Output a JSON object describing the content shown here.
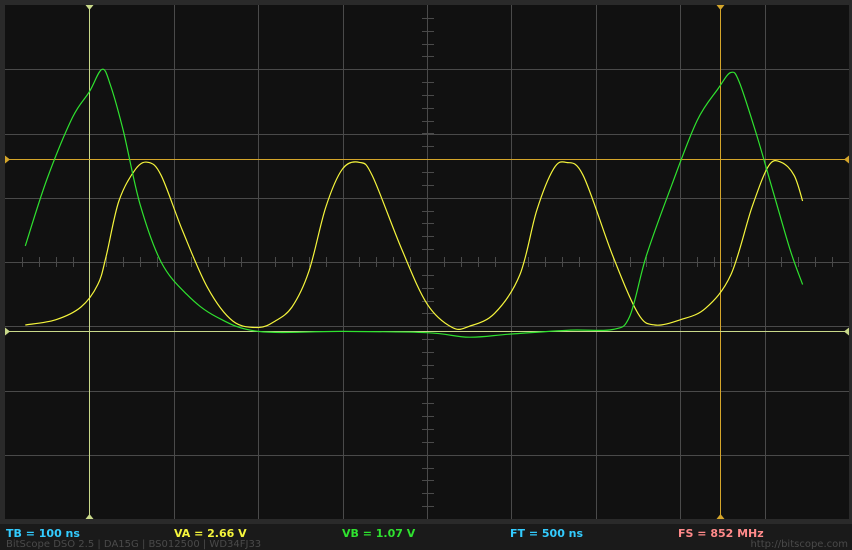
{
  "colors": {
    "background": "#111111",
    "frame": "#2a2a2a",
    "grid": "#4a4a4a",
    "channel_a": "#f5f53c",
    "channel_b": "#2fe22f",
    "cursor_a": "#d4a52a",
    "cursor_b": "#c9d98a",
    "tb": "#33ccff",
    "ft": "#33ccff",
    "fs": "#ff8a8a"
  },
  "readouts": {
    "tb": "TB = 100 ns",
    "va": "VA = 2.66 V",
    "vb": "VB = 1.07 V",
    "ft": "FT = 500 ns",
    "fs": "FS = 852 MHz"
  },
  "footer": {
    "left": "BitScope DSO 2.5 | DA15G | BS012500 | WD34FJ33",
    "right": "http://bitscope.com"
  },
  "chart_data": {
    "type": "line",
    "grid": {
      "divisions_x": 10,
      "divisions_y": 8
    },
    "xlim": [
      0,
      10
    ],
    "ylim": [
      -4,
      4
    ],
    "cursors": {
      "vertical": [
        {
          "channel": "B",
          "x": 1.0
        },
        {
          "channel": "A",
          "x": 8.47
        }
      ],
      "horizontal": [
        {
          "channel": "A",
          "y": 1.6
        },
        {
          "channel": "B",
          "y": -1.07
        }
      ]
    },
    "series": [
      {
        "channel": "A",
        "points": [
          [
            0.24,
            -0.98
          ],
          [
            0.6,
            -0.9
          ],
          [
            0.9,
            -0.7
          ],
          [
            1.1,
            -0.35
          ],
          [
            1.2,
            0.1
          ],
          [
            1.35,
            0.95
          ],
          [
            1.55,
            1.45
          ],
          [
            1.7,
            1.55
          ],
          [
            1.85,
            1.35
          ],
          [
            2.1,
            0.5
          ],
          [
            2.4,
            -0.4
          ],
          [
            2.7,
            -0.92
          ],
          [
            3.0,
            -1.02
          ],
          [
            3.2,
            -0.92
          ],
          [
            3.4,
            -0.7
          ],
          [
            3.6,
            -0.15
          ],
          [
            3.8,
            0.85
          ],
          [
            4.0,
            1.45
          ],
          [
            4.2,
            1.55
          ],
          [
            4.35,
            1.35
          ],
          [
            4.7,
            0.2
          ],
          [
            5.0,
            -0.65
          ],
          [
            5.3,
            -1.02
          ],
          [
            5.5,
            -1.0
          ],
          [
            5.8,
            -0.8
          ],
          [
            6.1,
            -0.2
          ],
          [
            6.3,
            0.8
          ],
          [
            6.5,
            1.45
          ],
          [
            6.65,
            1.55
          ],
          [
            6.85,
            1.35
          ],
          [
            7.2,
            0.1
          ],
          [
            7.5,
            -0.8
          ],
          [
            7.7,
            -0.98
          ],
          [
            8.0,
            -0.9
          ],
          [
            8.3,
            -0.72
          ],
          [
            8.6,
            -0.2
          ],
          [
            8.85,
            0.85
          ],
          [
            9.05,
            1.5
          ],
          [
            9.2,
            1.55
          ],
          [
            9.35,
            1.35
          ],
          [
            9.45,
            0.95
          ]
        ]
      },
      {
        "channel": "B",
        "points": [
          [
            0.24,
            0.25
          ],
          [
            0.5,
            1.3
          ],
          [
            0.8,
            2.25
          ],
          [
            1.0,
            2.65
          ],
          [
            1.15,
            3.0
          ],
          [
            1.25,
            2.75
          ],
          [
            1.4,
            2.05
          ],
          [
            1.6,
            0.9
          ],
          [
            1.85,
            0.0
          ],
          [
            2.15,
            -0.5
          ],
          [
            2.5,
            -0.85
          ],
          [
            3.0,
            -1.08
          ],
          [
            4.0,
            -1.08
          ],
          [
            5.0,
            -1.1
          ],
          [
            5.5,
            -1.17
          ],
          [
            6.0,
            -1.12
          ],
          [
            6.7,
            -1.06
          ],
          [
            7.2,
            -1.05
          ],
          [
            7.4,
            -0.85
          ],
          [
            7.6,
            0.1
          ],
          [
            7.9,
            1.2
          ],
          [
            8.2,
            2.2
          ],
          [
            8.45,
            2.7
          ],
          [
            8.6,
            2.95
          ],
          [
            8.7,
            2.8
          ],
          [
            8.9,
            2.0
          ],
          [
            9.1,
            1.1
          ],
          [
            9.3,
            0.2
          ],
          [
            9.45,
            -0.35
          ]
        ]
      }
    ]
  }
}
